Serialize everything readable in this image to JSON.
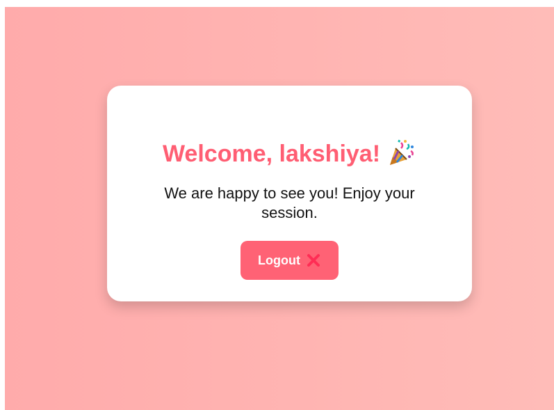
{
  "welcome": {
    "greeting": "Welcome, lakshiya!",
    "icon": "party-popper-icon"
  },
  "message": "We are happy to see you! Enjoy your session.",
  "logout": {
    "label": "Logout",
    "icon": "close-icon"
  },
  "colors": {
    "accent": "#ff5e73",
    "button": "#ff6275",
    "background_left": "#ffabab",
    "background_right": "#ffbcb8"
  }
}
